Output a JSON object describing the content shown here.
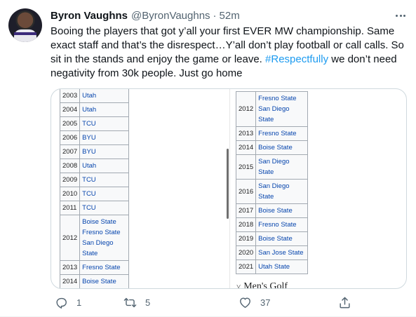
{
  "tweet": {
    "author_name": "Byron Vaughns",
    "author_handle": "@ByronVaughns",
    "separator": "·",
    "time": "52m",
    "text_before": "Booing the players that got y’all your first EVER MW championship. Same exact staff and that’s the disrespect…Y’all don’t play football or call calls. So sit in the stands and enjoy the game or leave. ",
    "hashtag": "#Respectfully",
    "text_after": " we don’t need negativity from 30k people. Just go home"
  },
  "media": {
    "left_table": [
      {
        "year": "2003",
        "schools": [
          "Utah"
        ]
      },
      {
        "year": "2004",
        "schools": [
          "Utah"
        ]
      },
      {
        "year": "2005",
        "schools": [
          "TCU"
        ]
      },
      {
        "year": "2006",
        "schools": [
          "BYU"
        ]
      },
      {
        "year": "2007",
        "schools": [
          "BYU"
        ]
      },
      {
        "year": "2008",
        "schools": [
          "Utah"
        ]
      },
      {
        "year": "2009",
        "schools": [
          "TCU"
        ]
      },
      {
        "year": "2010",
        "schools": [
          "TCU"
        ]
      },
      {
        "year": "2011",
        "schools": [
          "TCU"
        ]
      },
      {
        "year": "2012",
        "schools": [
          "Boise State",
          "Fresno State",
          "San Diego",
          "State"
        ]
      },
      {
        "year": "2013",
        "schools": [
          "Fresno State"
        ]
      },
      {
        "year": "2014",
        "schools": [
          "Boise State"
        ]
      }
    ],
    "right_table": [
      {
        "year": "2012",
        "schools": [
          "Fresno State",
          "San Diego",
          "State"
        ]
      },
      {
        "year": "2013",
        "schools": [
          "Fresno State"
        ]
      },
      {
        "year": "2014",
        "schools": [
          "Boise State"
        ]
      },
      {
        "year": "2015",
        "schools": [
          "San Diego",
          "State"
        ]
      },
      {
        "year": "2016",
        "schools": [
          "San Diego",
          "State"
        ]
      },
      {
        "year": "2017",
        "schools": [
          "Boise State"
        ]
      },
      {
        "year": "2018",
        "schools": [
          "Fresno State"
        ]
      },
      {
        "year": "2019",
        "schools": [
          "Boise State"
        ]
      },
      {
        "year": "2020",
        "schools": [
          "San Jose State"
        ]
      },
      {
        "year": "2021",
        "schools": [
          "Utah State"
        ]
      }
    ],
    "section_chevron": "˅",
    "section_heading": "Men's Golf"
  },
  "actions": {
    "reply_count": "1",
    "retweet_count": "5",
    "like_count": "37",
    "icons": [
      "reply-icon",
      "retweet-icon",
      "like-icon",
      "share-icon"
    ]
  },
  "colors": {
    "link": "#1d9bf0",
    "wiki_link": "#0645ad",
    "secondary_text": "#536471",
    "primary_text": "#0f1419"
  }
}
